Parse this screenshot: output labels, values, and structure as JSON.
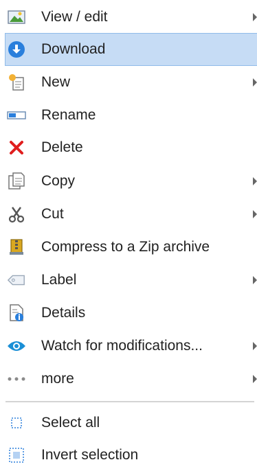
{
  "menu": {
    "items": [
      {
        "id": "view-edit",
        "label": "View / edit",
        "icon": "image-icon",
        "submenu": true
      },
      {
        "id": "download",
        "label": "Download",
        "icon": "download-icon",
        "submenu": false,
        "highlighted": true
      },
      {
        "id": "new",
        "label": "New",
        "icon": "new-document-icon",
        "submenu": true
      },
      {
        "id": "rename",
        "label": "Rename",
        "icon": "rename-icon",
        "submenu": false
      },
      {
        "id": "delete",
        "label": "Delete",
        "icon": "delete-icon",
        "submenu": false
      },
      {
        "id": "copy",
        "label": "Copy",
        "icon": "copy-icon",
        "submenu": true
      },
      {
        "id": "cut",
        "label": "Cut",
        "icon": "scissors-icon",
        "submenu": true
      },
      {
        "id": "compress",
        "label": "Compress to a Zip archive",
        "icon": "zip-archive-icon",
        "submenu": false
      },
      {
        "id": "label",
        "label": "Label",
        "icon": "tag-icon",
        "submenu": true
      },
      {
        "id": "details",
        "label": "Details",
        "icon": "details-icon",
        "submenu": false
      },
      {
        "id": "watch",
        "label": "Watch for modifications...",
        "icon": "eye-icon",
        "submenu": true
      },
      {
        "id": "more",
        "label": "more",
        "icon": "ellipsis-icon",
        "submenu": true
      }
    ],
    "selection_items": [
      {
        "id": "select-all",
        "label": "Select all",
        "icon": "select-all-icon",
        "submenu": false
      },
      {
        "id": "invert-selection",
        "label": "Invert selection",
        "icon": "invert-selection-icon",
        "submenu": false
      }
    ]
  },
  "colors": {
    "highlight_bg": "#c6dcf5",
    "highlight_border": "#90bbe9",
    "download_blue": "#2a7fdc",
    "delete_red": "#e01e1e",
    "eye_blue": "#1a8fd6",
    "text": "#222222"
  }
}
